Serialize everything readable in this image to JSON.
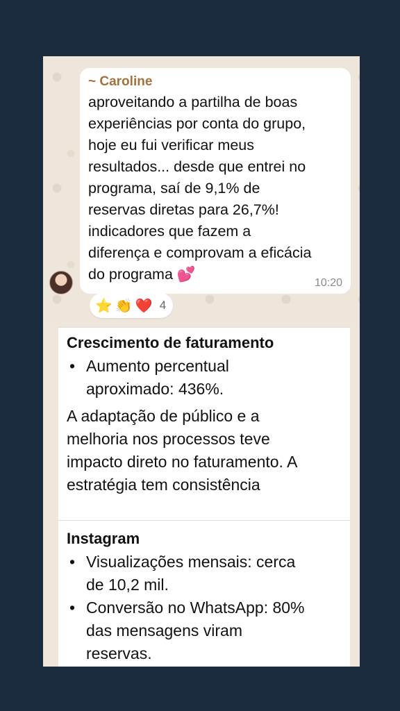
{
  "message": {
    "sender": "~ Caroline",
    "text": "aproveitando a partilha de boas\nexperiências por conta do grupo,\nhoje eu fui verificar meus\nresultados... desde que entrei no\nprograma, saí de 9,1% de\nreservas diretas para 26,7%!\nindicadores que fazem a\ndiferença e comprovam a eficácia\ndo programa 💕",
    "time": "10:20"
  },
  "reactions": {
    "emojis": [
      "⭐",
      "👏",
      "❤️"
    ],
    "count": "4"
  },
  "doc": {
    "section1": {
      "title": "Crescimento de faturamento",
      "bullet1": "Aumento percentual\naproximado: 436%.",
      "paragraph": "A adaptação de público e a\nmelhoria nos processos teve\nimpacto direto no faturamento. A\nestratégia tem consistência"
    },
    "section2": {
      "title": "Instagram",
      "bullet1": "Visualizações mensais: cerca\nde 10,2 mil.",
      "bullet2": "Conversão no WhatsApp: 80%\ndas mensagens viram\nreservas."
    }
  }
}
